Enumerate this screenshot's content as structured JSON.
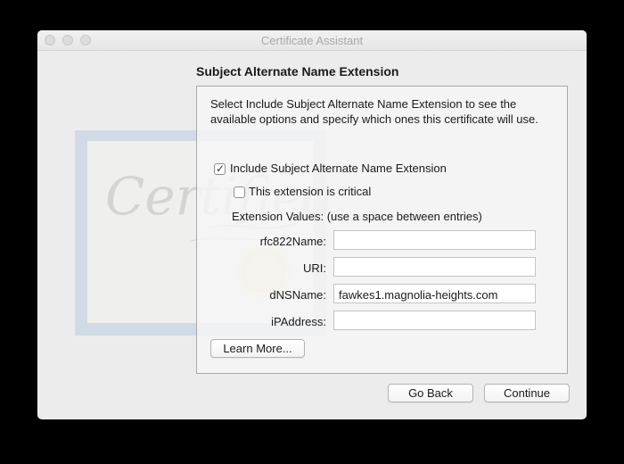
{
  "window": {
    "title": "Certificate Assistant"
  },
  "background_art": {
    "text": "Certified",
    "colors": {
      "frame": "#c9d5e3",
      "paper": "#f2f2ee",
      "seal": "#efe3b6"
    }
  },
  "section": {
    "title": "Subject Alternate Name Extension"
  },
  "panel": {
    "description": "Select Include Subject Alternate Name Extension to see the available options and specify which ones this certificate will use.",
    "include_checkbox": {
      "label": "Include Subject Alternate Name Extension",
      "checked": true
    },
    "critical_checkbox": {
      "label": "This extension is critical",
      "checked": false
    },
    "extension_values_label": "Extension Values: (use a space between entries)",
    "fields": [
      {
        "label": "rfc822Name:",
        "value": ""
      },
      {
        "label": "URI:",
        "value": ""
      },
      {
        "label": "dNSName:",
        "value": "fawkes1.magnolia-heights.com"
      },
      {
        "label": "iPAddress:",
        "value": ""
      }
    ],
    "learn_more_label": "Learn More..."
  },
  "buttons": {
    "go_back": "Go Back",
    "continue": "Continue"
  }
}
